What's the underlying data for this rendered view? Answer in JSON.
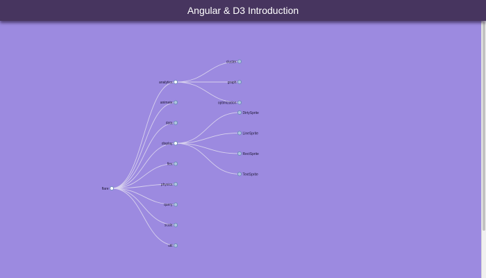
{
  "header": {
    "title": "Angular & D3 Introduction"
  },
  "tree": {
    "name": "flare",
    "collapsed_fill": "#b0c4de",
    "expanded_fill": "#ffffff",
    "children": [
      {
        "name": "analytics",
        "expanded": true,
        "children": [
          {
            "name": "cluster"
          },
          {
            "name": "graph"
          },
          {
            "name": "optimization"
          }
        ]
      },
      {
        "name": "animate"
      },
      {
        "name": "data"
      },
      {
        "name": "display",
        "expanded": true,
        "children": [
          {
            "name": "DirtySprite"
          },
          {
            "name": "LineSprite"
          },
          {
            "name": "RectSprite"
          },
          {
            "name": "TextSprite"
          }
        ]
      },
      {
        "name": "flex"
      },
      {
        "name": "physics"
      },
      {
        "name": "query"
      },
      {
        "name": "scale"
      },
      {
        "name": "util"
      }
    ]
  }
}
